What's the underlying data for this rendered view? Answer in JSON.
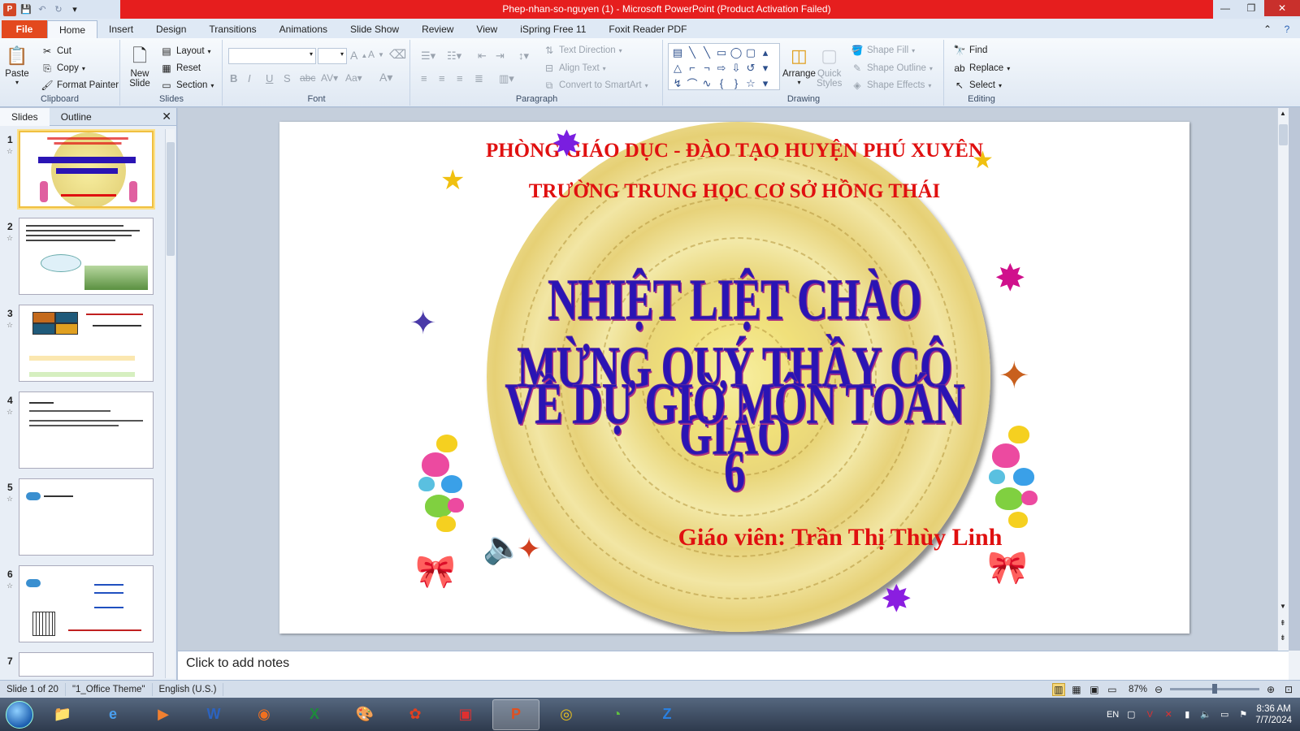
{
  "window": {
    "title": "Phep-nhan-so-nguyen (1)  -  Microsoft PowerPoint (Product Activation Failed)",
    "title_color": "#e61e1e"
  },
  "tabs": [
    "File",
    "Home",
    "Insert",
    "Design",
    "Transitions",
    "Animations",
    "Slide Show",
    "Review",
    "View",
    "iSpring Free 11",
    "Foxit Reader PDF"
  ],
  "active_tab": "Home",
  "ribbon": {
    "clipboard": {
      "label": "Clipboard",
      "paste": "Paste",
      "cut": "Cut",
      "copy": "Copy",
      "format_painter": "Format Painter"
    },
    "slides": {
      "label": "Slides",
      "new_slide_1": "New",
      "new_slide_2": "Slide",
      "layout": "Layout",
      "reset": "Reset",
      "section": "Section"
    },
    "font": {
      "label": "Font"
    },
    "paragraph": {
      "label": "Paragraph",
      "text_direction": "Text Direction",
      "align_text": "Align Text",
      "convert_smartart": "Convert to SmartArt"
    },
    "drawing": {
      "label": "Drawing",
      "arrange": "Arrange",
      "quick_styles_1": "Quick",
      "quick_styles_2": "Styles",
      "shape_fill": "Shape Fill",
      "shape_outline": "Shape Outline",
      "shape_effects": "Shape Effects"
    },
    "editing": {
      "label": "Editing",
      "find": "Find",
      "replace": "Replace",
      "select": "Select"
    }
  },
  "pane": {
    "tab_slides": "Slides",
    "tab_outline": "Outline",
    "slide_numbers": [
      "1",
      "2",
      "3",
      "4",
      "5",
      "6",
      "7"
    ]
  },
  "slide": {
    "line1": "PHÒNG GIÁO DỤC - ĐÀO TẠO HUYỆN PHÚ XUYÊN",
    "line2": "TRƯỜNG TRUNG HỌC CƠ SỞ HỒNG THÁI",
    "title1": "NHIỆT LIỆT CHÀO MỪNG  QUÝ THẦY CÔ GIÁO",
    "title2": "VỀ DỰ GIỜ MÔN TOÁN 6",
    "teacher": "Giáo viên: Trần Thị Thùy Linh",
    "text_color": "#e01010",
    "title_color": "#2a14b4"
  },
  "notes_placeholder": "Click to add notes",
  "status": {
    "slide_of": "Slide 1 of 20",
    "theme": "\"1_Office Theme\"",
    "language": "English (U.S.)",
    "zoom": "87%"
  },
  "taskbar": {
    "language": "EN",
    "time": "8:36 AM",
    "date": "7/7/2024"
  }
}
